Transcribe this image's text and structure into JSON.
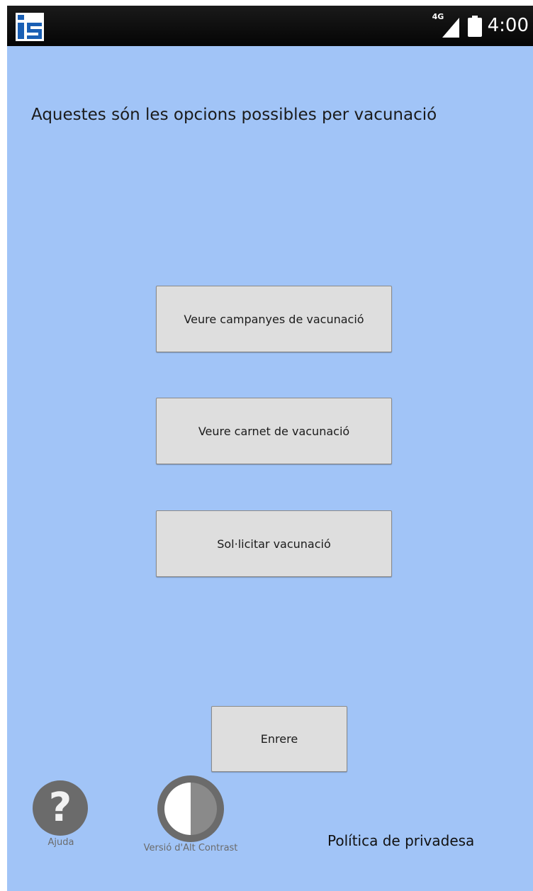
{
  "status_bar": {
    "network_type": "4G",
    "time": "4:00",
    "logo_icon": "is-logo-icon",
    "signal_icon": "signal-icon",
    "battery_icon": "battery-icon"
  },
  "screen": {
    "title": "Aquestes són les opcions possibles per vacunació",
    "background_color": "#a1c4f7"
  },
  "options": {
    "campaigns_label": "Veure campanyes de vacunació",
    "card_label": "Veure carnet de vacunació",
    "request_label": "Sol·licitar vacunació"
  },
  "back_label": "Enrere",
  "footer": {
    "help_icon": "question-mark-icon",
    "help_label": "Ajuda",
    "contrast_icon": "contrast-icon",
    "contrast_label": "Versió d'Alt Contrast",
    "privacy_label": "Política de privadesa"
  }
}
